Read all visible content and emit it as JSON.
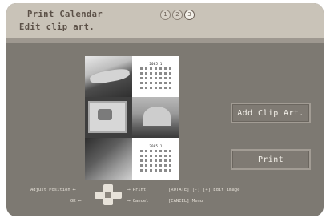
{
  "header": {
    "title": "Print Calendar",
    "subtitle": "Edit clip art.",
    "steps": [
      "1",
      "2",
      "3"
    ]
  },
  "buttons": {
    "add_clip_art": "Add Clip Art.",
    "print": "Print"
  },
  "preview": {
    "calendar_month_label": "2005 1"
  },
  "footer": {
    "adjust_position": "Adjust Position",
    "ok": "OK",
    "print": "Print",
    "cancel": "Cancel",
    "rotate_edit": "[ROTATE] [-] [+] Edit image",
    "cancel_menu": "[CANCEL] Menu"
  },
  "colors": {
    "background": "#7d7972",
    "header": "#c9c3b8",
    "title_text": "#5b5047"
  }
}
